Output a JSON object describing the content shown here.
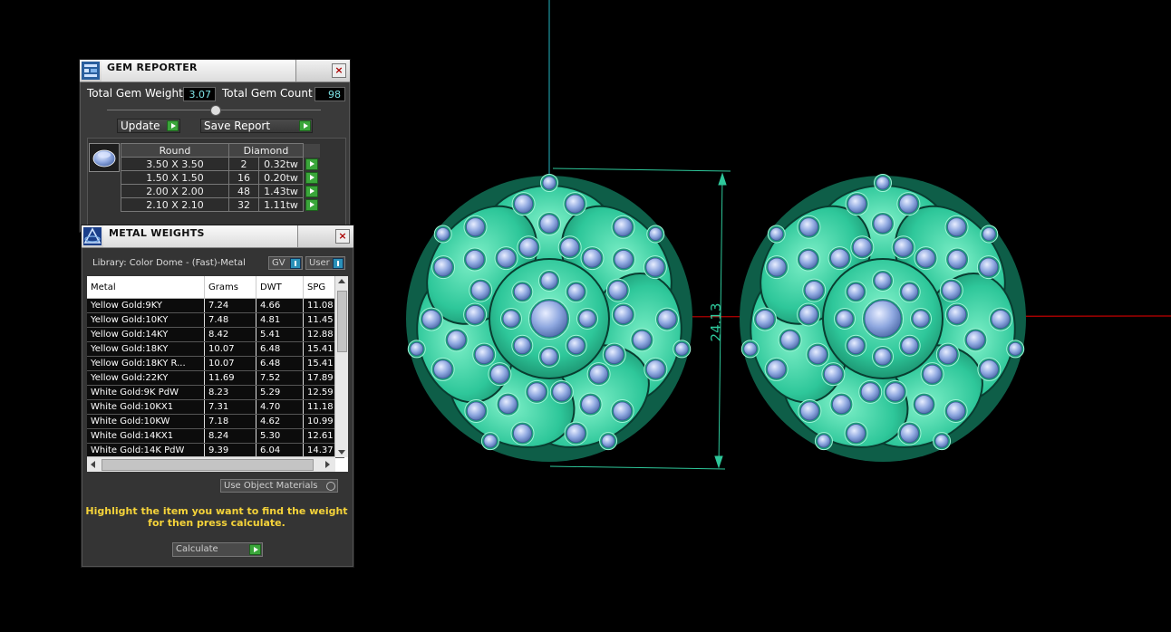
{
  "gem_reporter": {
    "title": "GEM REPORTER",
    "close": "×",
    "total_weight_label": "Total Gem Weight",
    "total_weight_value": "3.07",
    "total_count_label": "Total Gem Count",
    "total_count_value": "98",
    "update_label": "Update",
    "save_report_label": "Save Report",
    "shape_header": "Round",
    "material_header": "Diamond",
    "rows": [
      {
        "size": "3.50 X 3.50",
        "count": "2",
        "weight": "0.32tw"
      },
      {
        "size": "1.50 X 1.50",
        "count": "16",
        "weight": "0.20tw"
      },
      {
        "size": "2.00 X 2.00",
        "count": "48",
        "weight": "1.43tw"
      },
      {
        "size": "2.10 X 2.10",
        "count": "32",
        "weight": "1.11tw"
      }
    ]
  },
  "metal_weights": {
    "title": "METAL WEIGHTS",
    "close": "×",
    "library_text": "Library: Color Dome - (Fast)-Metal",
    "gv_label": "GV",
    "user_label": "User",
    "columns": [
      "Metal",
      "Grams",
      "DWT",
      "SPG"
    ],
    "rows": [
      {
        "metal": "Yellow Gold:9KY",
        "grams": "7.24",
        "dwt": "4.66",
        "spg": "11.08"
      },
      {
        "metal": "Yellow Gold:10KY",
        "grams": "7.48",
        "dwt": "4.81",
        "spg": "11.45"
      },
      {
        "metal": "Yellow Gold:14KY",
        "grams": "8.42",
        "dwt": "5.41",
        "spg": "12.88"
      },
      {
        "metal": "Yellow Gold:18KY",
        "grams": "10.07",
        "dwt": "6.48",
        "spg": "15.41"
      },
      {
        "metal": "Yellow Gold:18KY R...",
        "grams": "10.07",
        "dwt": "6.48",
        "spg": "15.41"
      },
      {
        "metal": "Yellow Gold:22KY",
        "grams": "11.69",
        "dwt": "7.52",
        "spg": "17.89"
      },
      {
        "metal": "White Gold:9K PdW",
        "grams": "8.23",
        "dwt": "5.29",
        "spg": "12.59"
      },
      {
        "metal": "White Gold:10KX1",
        "grams": "7.31",
        "dwt": "4.70",
        "spg": "11.18"
      },
      {
        "metal": "White Gold:10KW",
        "grams": "7.18",
        "dwt": "4.62",
        "spg": "10.99"
      },
      {
        "metal": "White Gold:14KX1",
        "grams": "8.24",
        "dwt": "5.30",
        "spg": "12.61"
      },
      {
        "metal": "White Gold:14K PdW",
        "grams": "9.39",
        "dwt": "6.04",
        "spg": "14.37"
      }
    ],
    "use_object_materials": "Use Object Materials",
    "hint_line1": "Highlight the item you want to find the weight",
    "hint_line2": "for then press calculate.",
    "calculate_label": "Calculate"
  },
  "viewport": {
    "dimension_label": "24.13",
    "colors": {
      "metal": "#2ec79a",
      "gem": "#8fa8e0",
      "axis_red": "#c00000",
      "axis_cyan": "#25b5c0"
    }
  }
}
